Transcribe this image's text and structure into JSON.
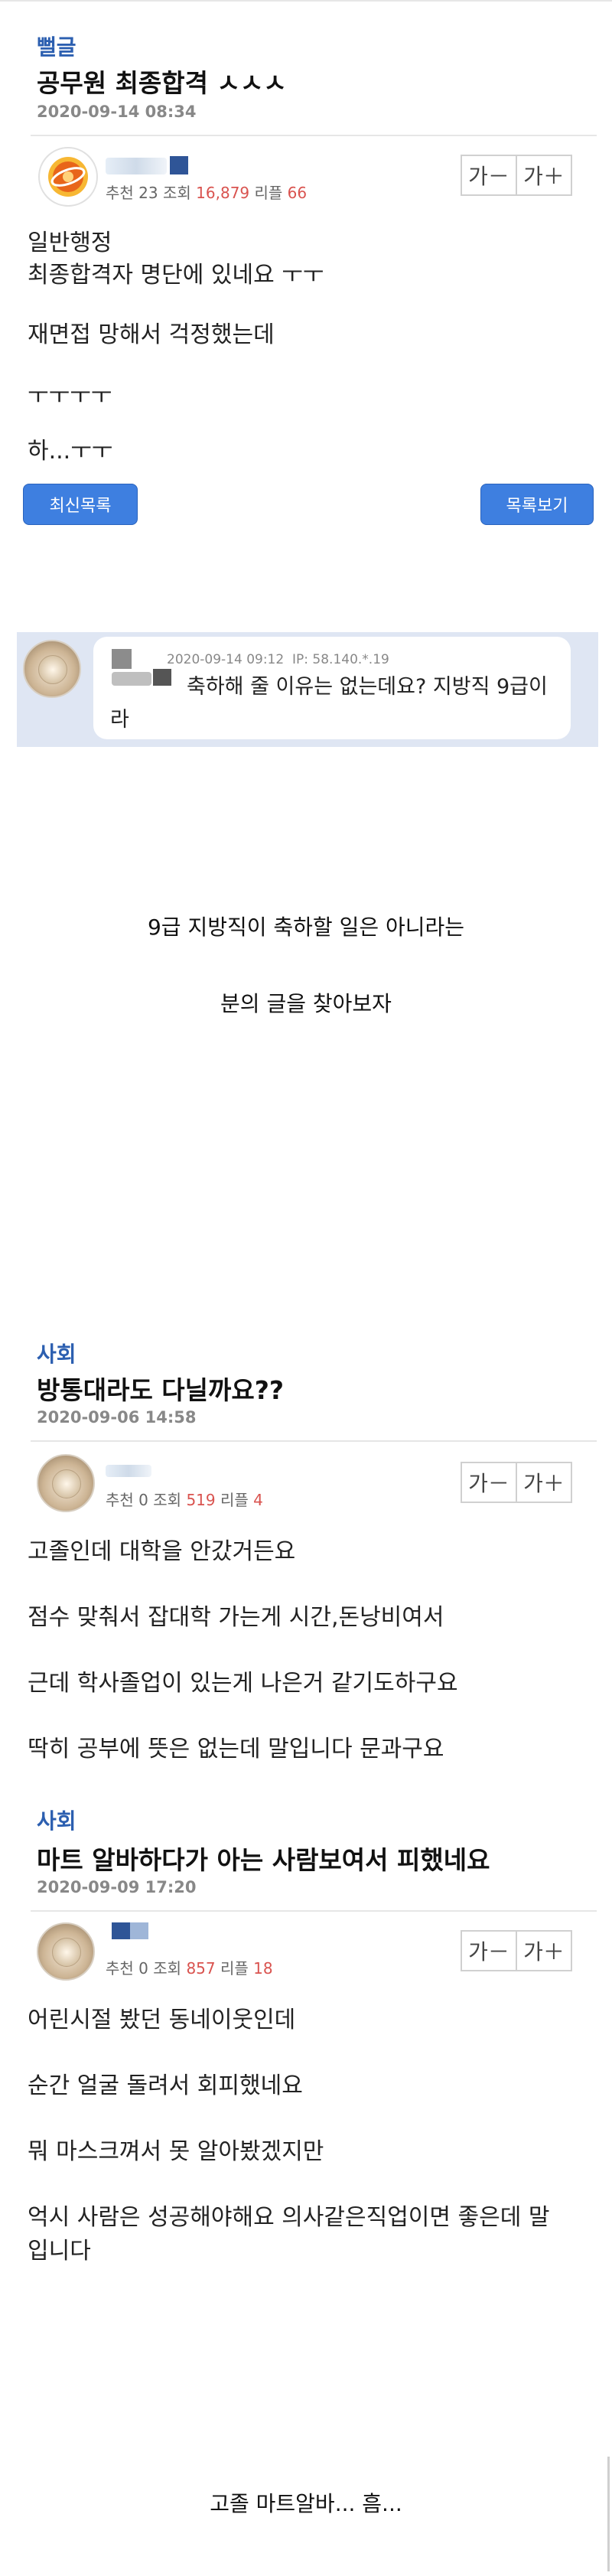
{
  "post1": {
    "category": "뻘글",
    "title": "공무원 최종합격 ㅅㅅㅅ",
    "date": "2020-09-14 08:34",
    "stats": {
      "rec_label": "추천",
      "rec": "23",
      "views_label": "조회",
      "views": "16,879",
      "reply_label": "리플",
      "replies": "66"
    },
    "font_down": "가－",
    "font_up": "가＋",
    "lines": [
      "일반행정",
      "최종합격자 명단에 있네요 ㅜㅜ",
      "재면접 망해서 걱정했는데",
      "ㅜㅜㅜㅜ",
      "하...ㅜㅜ"
    ],
    "btn_latest": "최신목록",
    "btn_list": "목록보기"
  },
  "comment": {
    "date": "2020-09-14 09:12",
    "ip": "IP: 58.140.*.19",
    "text": "축하해 줄 이유는 없는데요? 지방직 9급이라"
  },
  "caption1": {
    "line1": "9급 지방직이 축하할 일은 아니라는",
    "line2": "분의 글을 찾아보자"
  },
  "post2": {
    "category": "사회",
    "title": "방통대라도 다닐까요??",
    "date": "2020-09-06 14:58",
    "stats": {
      "rec_label": "추천",
      "rec": "0",
      "views_label": "조회",
      "views": "519",
      "reply_label": "리플",
      "replies": "4"
    },
    "font_down": "가－",
    "font_up": "가＋",
    "lines": [
      "고졸인데 대학을 안갔거든요",
      "점수 맞춰서 잡대학 가는게 시간,돈낭비여서",
      "근데 학사졸업이 있는게 나은거 같기도하구요",
      "딱히 공부에 뜻은 없는데 말입니다 문과구요"
    ]
  },
  "post3": {
    "category": "사회",
    "title": "마트 알바하다가 아는 사람보여서 피했네요",
    "date": "2020-09-09 17:20",
    "stats": {
      "rec_label": "추천",
      "rec": "0",
      "views_label": "조회",
      "views": "857",
      "reply_label": "리플",
      "replies": "18"
    },
    "font_down": "가－",
    "font_up": "가＋",
    "lines": [
      "어린시절 봤던 동네이웃인데",
      "순간 얼굴 돌려서 회피했네요",
      "뭐 마스크껴서 못 알아봤겠지만",
      "억시 사람은 성공해야해요 의사같은직업이면 좋은데 말",
      "입니다"
    ]
  },
  "caption2": "고졸 마트알바... 흠...",
  "colors": {
    "category": "#2c5fb0",
    "button": "#3e7fe0",
    "red": "#d9534f"
  }
}
